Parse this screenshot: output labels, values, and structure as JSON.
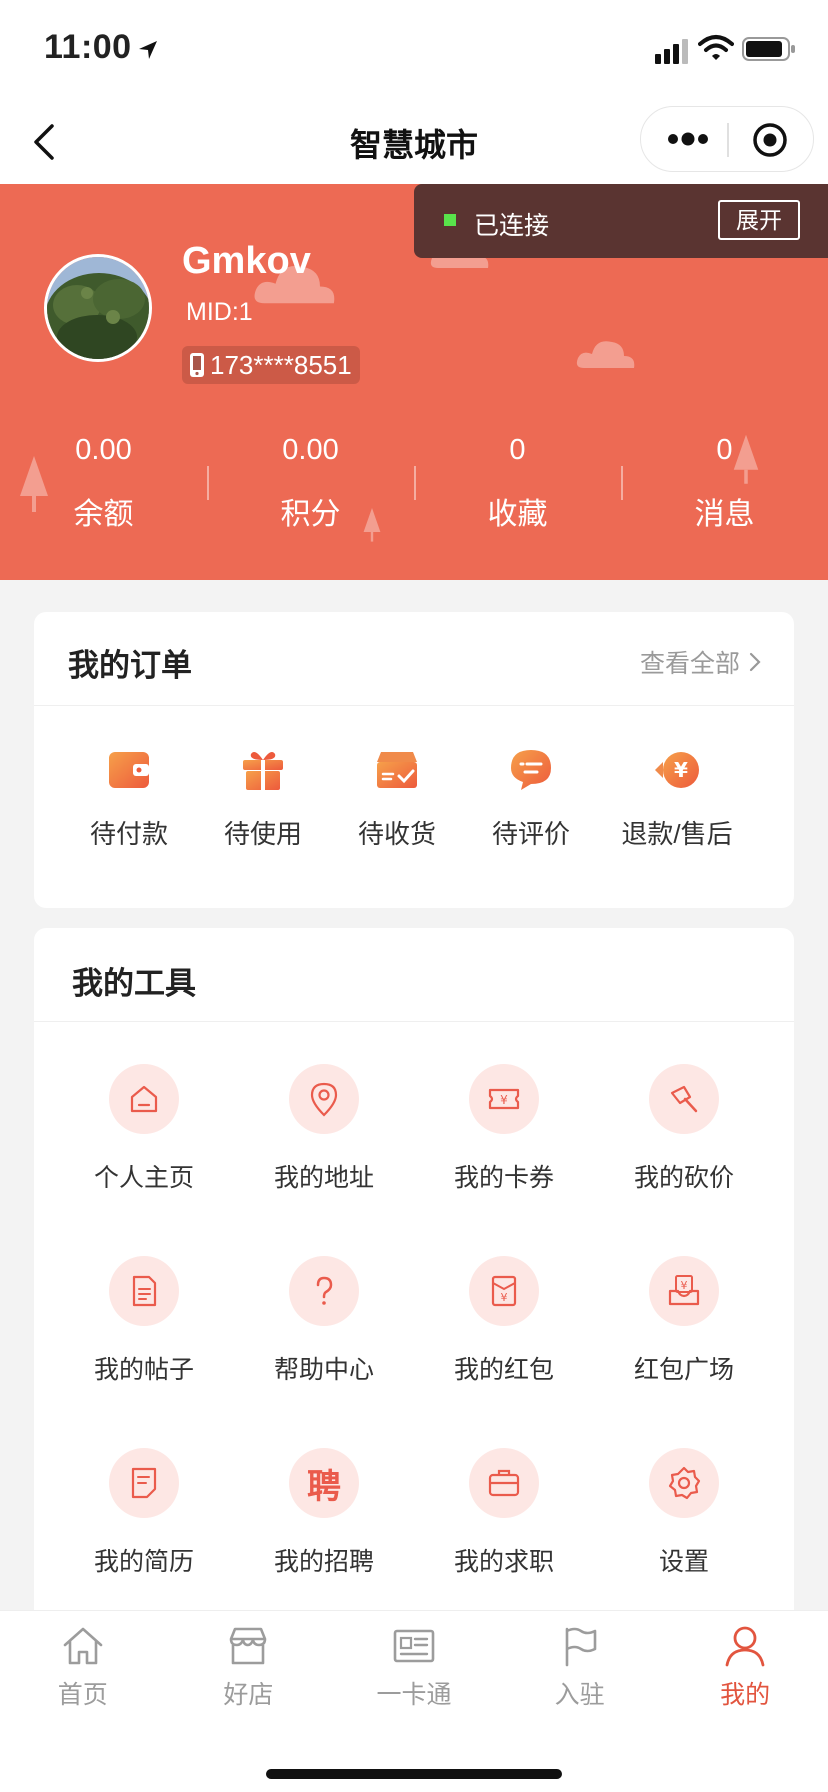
{
  "status_bar": {
    "time": "11:00"
  },
  "nav": {
    "title": "智慧城市"
  },
  "connection": {
    "status": "已连接",
    "expand_label": "展开"
  },
  "profile": {
    "username": "Gmkov",
    "mid": "MID:1",
    "phone": "173****8551"
  },
  "stats": [
    {
      "value": "0.00",
      "label": "余额"
    },
    {
      "value": "0.00",
      "label": "积分"
    },
    {
      "value": "0",
      "label": "收藏"
    },
    {
      "value": "0",
      "label": "消息"
    }
  ],
  "orders": {
    "title": "我的订单",
    "view_all": "查看全部",
    "items": [
      {
        "label": "待付款",
        "icon": "wallet-icon"
      },
      {
        "label": "待使用",
        "icon": "gift-icon"
      },
      {
        "label": "待收货",
        "icon": "box-icon"
      },
      {
        "label": "待评价",
        "icon": "comment-icon"
      },
      {
        "label": "退款/售后",
        "icon": "refund-icon"
      }
    ]
  },
  "tools": {
    "title": "我的工具",
    "items": [
      {
        "label": "个人主页",
        "icon": "home-icon"
      },
      {
        "label": "我的地址",
        "icon": "location-icon"
      },
      {
        "label": "我的卡券",
        "icon": "coupon-icon"
      },
      {
        "label": "我的砍价",
        "icon": "axe-icon"
      },
      {
        "label": "我的帖子",
        "icon": "document-icon"
      },
      {
        "label": "帮助中心",
        "icon": "question-icon"
      },
      {
        "label": "我的红包",
        "icon": "red-envelope-icon"
      },
      {
        "label": "红包广场",
        "icon": "envelope-inbox-icon"
      },
      {
        "label": "我的简历",
        "icon": "resume-icon"
      },
      {
        "label": "我的招聘",
        "icon": "recruit-icon",
        "glyph": "聘"
      },
      {
        "label": "我的求职",
        "icon": "briefcase-icon"
      },
      {
        "label": "设置",
        "icon": "gear-icon"
      }
    ]
  },
  "tabbar": {
    "tabs": [
      {
        "label": "首页",
        "icon": "home-tab-icon"
      },
      {
        "label": "好店",
        "icon": "store-tab-icon"
      },
      {
        "label": "一卡通",
        "icon": "card-tab-icon"
      },
      {
        "label": "入驻",
        "icon": "flag-tab-icon"
      },
      {
        "label": "我的",
        "icon": "user-tab-icon",
        "active": true
      }
    ]
  },
  "colors": {
    "brand": "#ed6a54",
    "accent_red": "#e2553f",
    "icon_bg": "#fde7e4",
    "connected_green": "#59e34b"
  }
}
